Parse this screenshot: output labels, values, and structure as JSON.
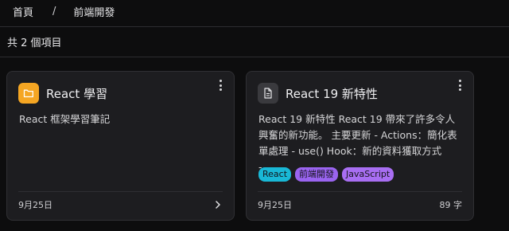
{
  "breadcrumb": {
    "home": "首頁",
    "separator": "/",
    "current": "前端開發"
  },
  "list": {
    "count_text": "共 2 個項目"
  },
  "cards": [
    {
      "title": "React 學習",
      "icon": "folder-icon",
      "description": "React 框架學習筆記",
      "date": "9月25日",
      "tags": []
    },
    {
      "title": "React 19 新特性",
      "icon": "document-icon",
      "description": "React 19 新特性 React 19 帶來了許多令人興奮的新功能。 主要更新 - Actions：簡化表單處理 - use() Hook：新的資料獲取方式 -...",
      "date": "9月25日",
      "word_count": "89 字",
      "tags": [
        "React",
        "前端開發",
        "JavaScript"
      ]
    }
  ],
  "colors": {
    "background": "#0d0d0e",
    "card": "#1d1d20",
    "folder_accent": "#f5a623",
    "tag_react": "#19b8d6",
    "tag_frontend": "#9a64f0",
    "tag_javascript": "#a86ef2"
  }
}
